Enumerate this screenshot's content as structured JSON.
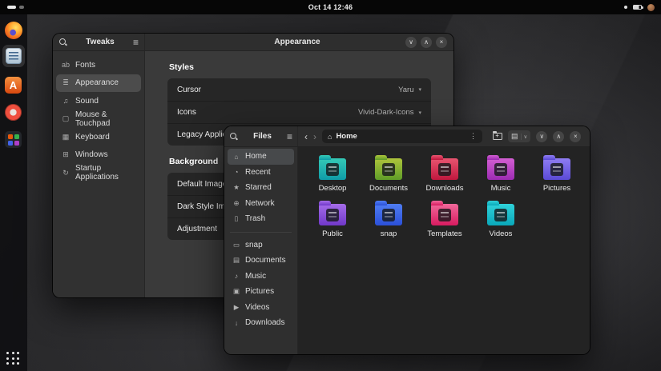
{
  "topbar": {
    "clock": "Oct 14 12:46"
  },
  "icons": {
    "minimize": "∨",
    "maximize": "∧",
    "close": "×",
    "back": "‹",
    "forward": "›",
    "menu": "≡",
    "more": "⋮",
    "dropdown": "∨",
    "view_list": "▤",
    "home": "⌂",
    "combo_arrow": "▾",
    "search": "magnifier-css",
    "new_folder": "folder-plus-css"
  },
  "dock": {
    "a_label": "A",
    "items": [
      "firefox",
      "text-editor",
      "a-app",
      "help",
      "software"
    ],
    "active": "text-editor"
  },
  "tweaks_window": {
    "title": "Tweaks",
    "page_title": "Appearance",
    "sidebar": [
      {
        "label": "Fonts",
        "glyph": "ab"
      },
      {
        "label": "Appearance",
        "glyph": "≣",
        "selected": true
      },
      {
        "label": "Sound",
        "glyph": "♫"
      },
      {
        "label": "Mouse & Touchpad",
        "glyph": "▢"
      },
      {
        "label": "Keyboard",
        "glyph": "▦"
      },
      {
        "label": "Windows",
        "glyph": "⊞"
      },
      {
        "label": "Startup Applications",
        "glyph": "↻"
      }
    ],
    "sections": {
      "styles": {
        "heading": "Styles",
        "rows": [
          {
            "label": "Cursor",
            "value": "Yaru"
          },
          {
            "label": "Icons",
            "value": "Vivid-Dark-Icons"
          },
          {
            "label": "Legacy Applications",
            "value": ""
          }
        ]
      },
      "background": {
        "heading": "Background",
        "rows": [
          {
            "label": "Default Image"
          },
          {
            "label": "Dark Style Image"
          },
          {
            "label": "Adjustment"
          }
        ]
      }
    }
  },
  "files_window": {
    "title": "Files",
    "path": "Home",
    "sidebar": [
      {
        "label": "Home",
        "glyph": "⌂",
        "selected": true
      },
      {
        "label": "Recent",
        "glyph": "◔"
      },
      {
        "label": "Starred",
        "glyph": "★"
      },
      {
        "label": "Network",
        "glyph": "⊕"
      },
      {
        "label": "Trash",
        "glyph": "▯"
      },
      {
        "label": "snap",
        "glyph": "▭"
      },
      {
        "label": "Documents",
        "glyph": "▤"
      },
      {
        "label": "Music",
        "glyph": "♪"
      },
      {
        "label": "Pictures",
        "glyph": "▣"
      },
      {
        "label": "Videos",
        "glyph": "▶"
      },
      {
        "label": "Downloads",
        "glyph": "↓"
      }
    ],
    "folders": [
      {
        "label": "Desktop",
        "color_top": "#35c9b6",
        "color_bottom": "#0f9ca8"
      },
      {
        "label": "Documents",
        "color_top": "#aec43c",
        "color_bottom": "#5f9d28"
      },
      {
        "label": "Downloads",
        "color_top": "#e85570",
        "color_bottom": "#c0173e"
      },
      {
        "label": "Music",
        "color_top": "#d35fd3",
        "color_bottom": "#9c2bb2"
      },
      {
        "label": "Pictures",
        "color_top": "#8f7df2",
        "color_bottom": "#5a4ad6"
      },
      {
        "label": "Public",
        "color_top": "#a56ce9",
        "color_bottom": "#7038c9"
      },
      {
        "label": "snap",
        "color_top": "#4f7df2",
        "color_bottom": "#2b50d9"
      },
      {
        "label": "Templates",
        "color_top": "#f0689a",
        "color_bottom": "#d81b60"
      },
      {
        "label": "Videos",
        "color_top": "#2fd2da",
        "color_bottom": "#0aa8ba"
      }
    ]
  }
}
